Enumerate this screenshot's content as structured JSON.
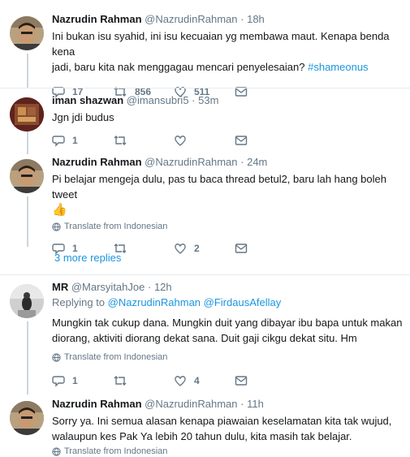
{
  "tweets": [
    {
      "name": "Nazrudin Rahman",
      "handle": "@NazrudinRahman",
      "time": "18h",
      "text_lines": [
        "Ini bukan isu syahid, ini isu kecuaian yg membawa maut. Kenapa benda kena",
        "jadi, baru kita nak menggagau mencari penyelesaian?"
      ],
      "hashtag": "#shameonus",
      "replies": "17",
      "retweets": "856",
      "likes": "511"
    },
    {
      "name": "iman shazwan",
      "handle": "@imansubri5",
      "time": "53m",
      "text": "Jgn jdi budus",
      "replies": "1",
      "retweets": "",
      "likes": ""
    },
    {
      "name": "Nazrudin Rahman",
      "handle": "@NazrudinRahman",
      "time": "24m",
      "text_lines": [
        "Pi belajar mengeja dulu, pas tu baca thread betul2, baru lah hang boleh tweet"
      ],
      "emoji": "👍",
      "translate": "Translate from Indonesian",
      "replies": "1",
      "retweets": "",
      "likes": "2"
    },
    {
      "name": "MR",
      "handle": "@MarsyitahJoe",
      "time": "12h",
      "replying_prefix": "Replying to",
      "replying_1": "@NazrudinRahman",
      "replying_2": "@FirdausAfellay",
      "text_lines": [
        "Mungkin tak cukup dana. Mungkin duit yang dibayar ibu bapa untuk makan",
        "diorang, aktiviti diorang dekat sana. Duit gaji cikgu dekat situ. Hm"
      ],
      "translate": "Translate from Indonesian",
      "replies": "1",
      "retweets": "",
      "likes": "4"
    },
    {
      "name": "Nazrudin Rahman",
      "handle": "@NazrudinRahman",
      "time": "11h",
      "text_lines": [
        "Sorry ya. Ini semua alasan kenapa piawaian keselamatan kita tak wujud,",
        "walaupun kes Pak Ya lebih 20 tahun dulu, kita masih tak belajar."
      ],
      "translate": "Translate from Indonesian"
    }
  ],
  "more_replies": "3 more replies",
  "header_sep": "·",
  "colors": {
    "link": "#1b95e0",
    "muted": "#657786",
    "thread_line": "#ccd6dd"
  }
}
